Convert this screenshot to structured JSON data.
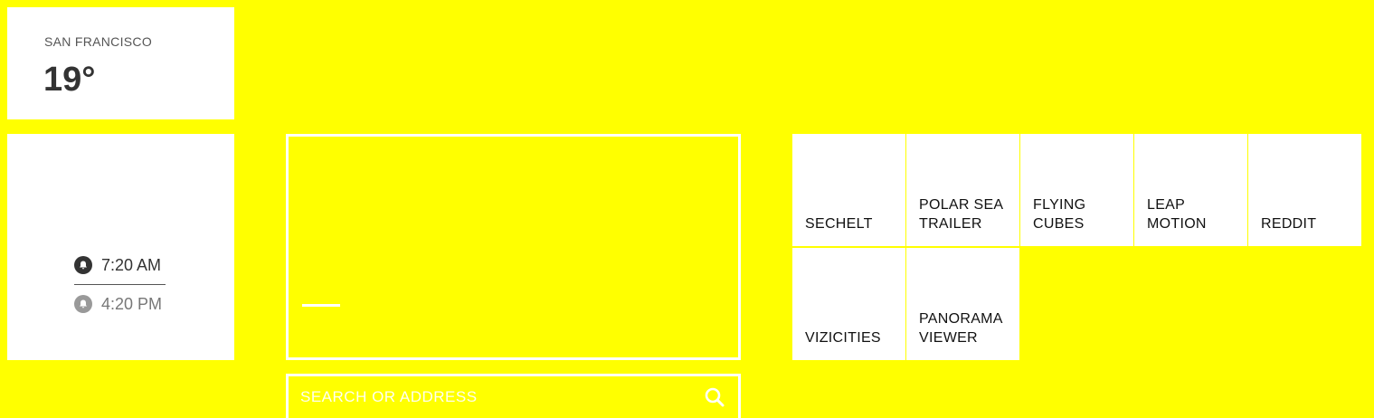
{
  "weather": {
    "city": "SAN FRANCISCO",
    "temperature": "19°"
  },
  "alarms": [
    {
      "time": "7:20 AM",
      "icon": "bell-icon"
    },
    {
      "time": "4:20 PM",
      "icon": "bell-icon"
    }
  ],
  "search": {
    "placeholder": "SEARCH OR ADDRESS",
    "value": "",
    "icon": "search-icon"
  },
  "bookmarks": [
    {
      "label": "SECHELT"
    },
    {
      "label": "POLAR SEA\nTRAILER"
    },
    {
      "label": "FLYING\nCUBES"
    },
    {
      "label": "LEAP\nMOTION"
    },
    {
      "label": "REDDIT"
    },
    {
      "label": "VIZICITIES"
    },
    {
      "label": "PANORAMA\nVIEWER"
    }
  ],
  "colors": {
    "background": "#ffff00",
    "tile": "#ffffff",
    "text_dark": "#333333"
  }
}
